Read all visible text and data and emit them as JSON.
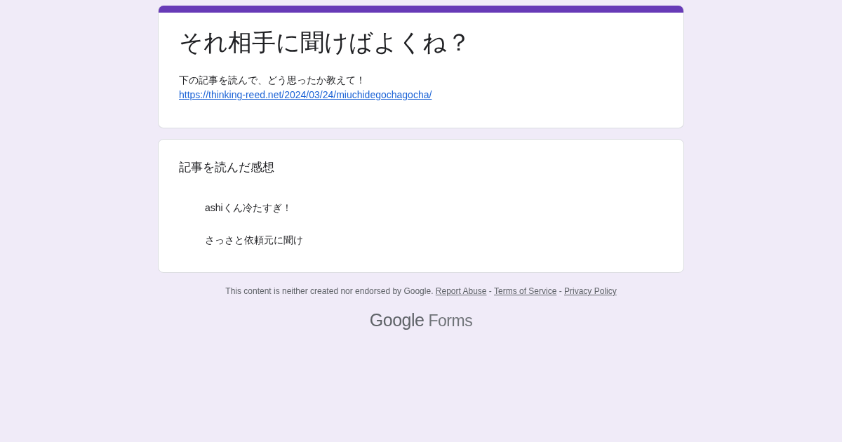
{
  "header": {
    "title": "それ相手に聞けばよくね？",
    "description": "下の記事を読んで、どう思ったか教えて！",
    "link": "https://thinking-reed.net/2024/03/24/miuchidegochagocha/"
  },
  "question": {
    "title": "記事を読んだ感想",
    "answers": [
      "ashiくん冷たすぎ！",
      "さっさと依頼元に聞け"
    ]
  },
  "footer": {
    "notice": "This content is neither created nor endorsed by Google.",
    "links": [
      "Report Abuse",
      "Terms of Service",
      "Privacy Policy"
    ],
    "separator": "-"
  },
  "logo": {
    "brand": "Google",
    "product": "Forms"
  }
}
